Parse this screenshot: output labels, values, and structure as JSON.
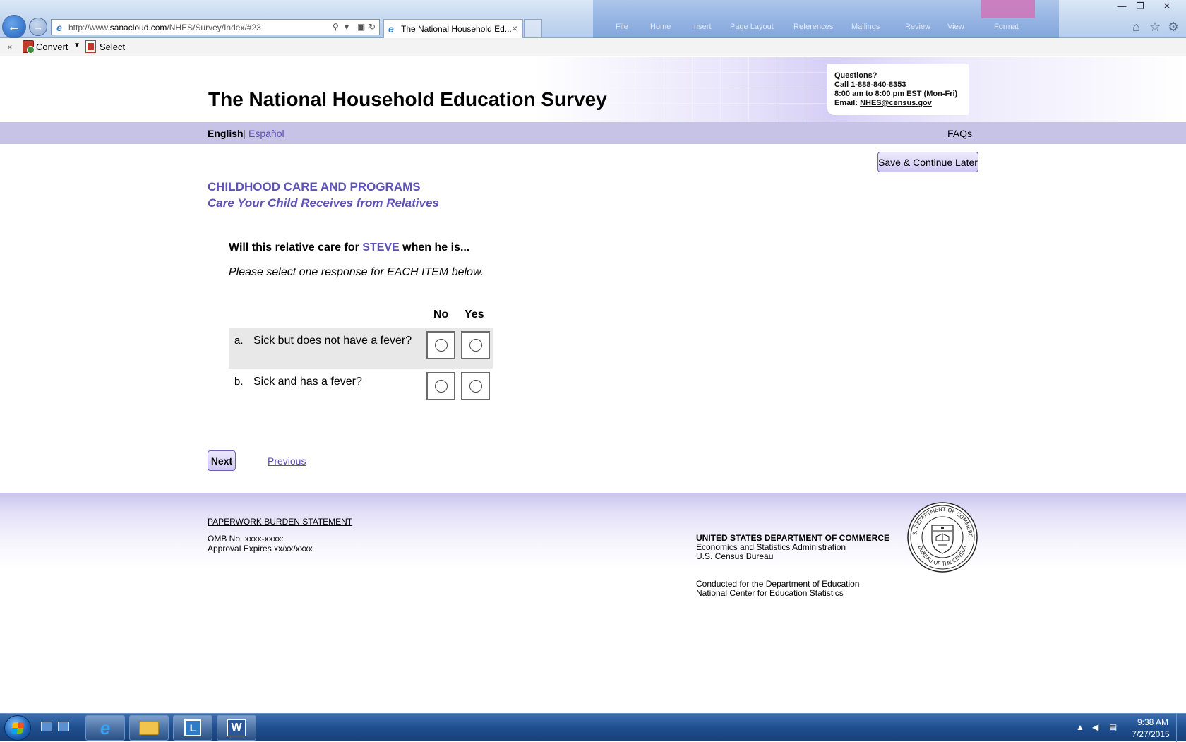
{
  "browser": {
    "url_prefix": "http://www.",
    "url_domain": "sanacloud.com",
    "url_path": "/NHES/Survey/Index/#23",
    "tab_title": "The National Household Ed...",
    "tab_close": "×",
    "command_bar": {
      "close": "×",
      "convert_label": "Convert",
      "select_label": "Select"
    },
    "background_window_menu": [
      "File",
      "Home",
      "Insert",
      "Page Layout",
      "References",
      "Mailings",
      "Review",
      "View",
      "Format"
    ]
  },
  "header": {
    "title": "The National Household Education Survey",
    "contact": {
      "heading": "Questions?",
      "phone": "Call 1-888-840-8353",
      "hours": "8:00 am to 8:00 pm EST (Mon-Fri)",
      "email_label": "Email: ",
      "email": "NHES@census.gov"
    }
  },
  "language_bar": {
    "english": "English",
    "separator": "|",
    "espanol": "Español",
    "faqs": "FAQs"
  },
  "save_button": "Save & Continue Later",
  "section": {
    "title": "CHILDHOOD CARE AND PROGRAMS",
    "subtitle": "Care Your Child Receives from Relatives"
  },
  "question": {
    "prefix": "Will this relative care for ",
    "name": "STEVE",
    "suffix": " when he is...",
    "instruction": "Please select one response for EACH ITEM below.",
    "columns": {
      "no": "No",
      "yes": "Yes"
    },
    "items": [
      {
        "letter": "a.",
        "label": "Sick but does not have a fever?"
      },
      {
        "letter": "b.",
        "label": "Sick and has a fever?"
      }
    ]
  },
  "navigation": {
    "next": "Next",
    "previous": "Previous"
  },
  "footer": {
    "paperwork": "PAPERWORK BURDEN STATEMENT",
    "omb": "OMB No. xxxx-xxxx:",
    "approval": "Approval Expires xx/xx/xxxx",
    "dept_name": "UNITED STATES DEPARTMENT OF COMMERCE",
    "dept_line2": "Economics and Statistics Administration",
    "dept_line3": "U.S. Census Bureau",
    "conducted_line1": "Conducted for the Department of Education",
    "conducted_line2": "National Center for Education Statistics",
    "seal_top": "U.S. DEPARTMENT OF COMMERCE",
    "seal_bottom": "BUREAU OF THE CENSUS"
  },
  "taskbar": {
    "lync_letter": "L",
    "word_letter": "W",
    "time": "9:38 AM",
    "date": "7/27/2015"
  },
  "colors": {
    "accent_purple": "#5d52b6",
    "lang_bar": "#c7c3e6",
    "row_shade": "#e8e8e8"
  }
}
